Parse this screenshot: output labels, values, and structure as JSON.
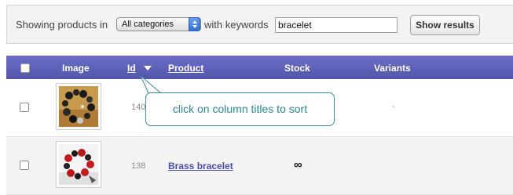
{
  "filter": {
    "showing_label": "Showing products in",
    "category_selected": "All categories",
    "keywords_label": "with keywords",
    "keywords_value": "bracelet",
    "show_button": "Show results"
  },
  "table": {
    "headers": {
      "image": "Image",
      "id": "Id",
      "product": "Product",
      "stock": "Stock",
      "variants": "Variants"
    },
    "sort_indicator": "chevron-down-icon",
    "rows": [
      {
        "id": "140",
        "product": "",
        "stock": "",
        "variants": "-"
      },
      {
        "id": "138",
        "product": "Brass bracelet",
        "stock": "∞",
        "variants": ""
      }
    ]
  },
  "tooltip": {
    "text": "click on column titles to sort"
  },
  "colors": {
    "header_bg": "#5f62b8",
    "link": "#4a4fa8",
    "tooltip_border": "#3b8f9a",
    "tooltip_text": "#2d8892"
  }
}
